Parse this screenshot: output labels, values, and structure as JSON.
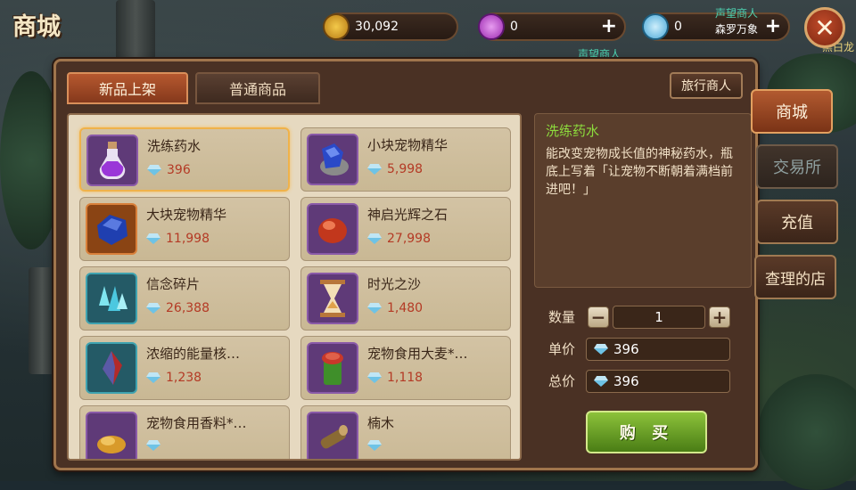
{
  "header": {
    "title": "商城",
    "gold": "30,092",
    "crystal": "0",
    "diamond": "0",
    "npc_label_top": "声望商人",
    "npc_label_sub": "森罗万象",
    "npc_label_mid": "声望商人",
    "npc_label_right": "黑白龙"
  },
  "tabs": [
    "新品上架",
    "普通商品"
  ],
  "merchant_label": "旅行商人",
  "items": [
    {
      "name": "洗练药水",
      "price": "396",
      "icon": "potion-icon"
    },
    {
      "name": "小块宠物精华",
      "price": "5,998",
      "icon": "blue-crystal-icon"
    },
    {
      "name": "大块宠物精华",
      "price": "11,998",
      "icon": "blue-gem-icon"
    },
    {
      "name": "神启光辉之石",
      "price": "27,998",
      "icon": "red-stone-icon"
    },
    {
      "name": "信念碎片",
      "price": "26,388",
      "icon": "crystal-shards-icon"
    },
    {
      "name": "时光之沙",
      "price": "1,480",
      "icon": "hourglass-icon"
    },
    {
      "name": "浓缩的能量核…",
      "price": "1,238",
      "icon": "energy-core-icon"
    },
    {
      "name": "宠物食用大麦*…",
      "price": "1,118",
      "icon": "barley-icon"
    },
    {
      "name": "宠物食用香料*…",
      "price": "",
      "icon": "spice-icon"
    },
    {
      "name": "楠木",
      "price": "",
      "icon": "wood-icon"
    }
  ],
  "detail": {
    "title": "洗练药水",
    "desc": "能改变宠物成长值的神秘药水，瓶底上写着「让宠物不断朝着满档前进吧！」",
    "qty_label": "数量",
    "qty": "1",
    "unit_label": "单价",
    "unit_price": "396",
    "total_label": "总价",
    "total_price": "396",
    "buy_label": "购 买"
  },
  "side_nav": [
    "商城",
    "交易所",
    "充值",
    "查理的店"
  ],
  "colors": {
    "accent": "#b6582f",
    "price": "#b43a25",
    "detail_title": "#8ddc3d",
    "buy": "#6ba127"
  }
}
